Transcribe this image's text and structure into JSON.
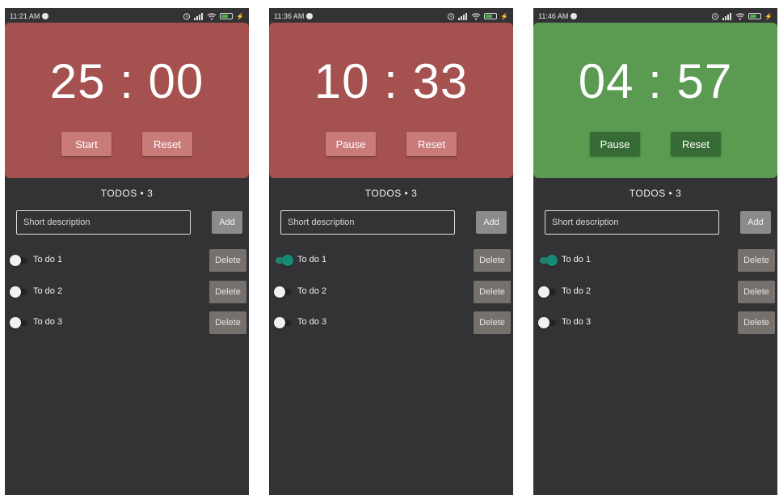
{
  "colors": {
    "app_bg": "#333336",
    "timer_red": "#a45150",
    "timer_green": "#5a9a51",
    "btn_red": "#c97b7a",
    "btn_green": "#376b36",
    "switch_on": "#178a76",
    "battery_fill": "#4cb34a",
    "delete_btn": "#77716d",
    "add_btn": "#8b8b8b"
  },
  "screens": [
    {
      "status": {
        "time": "11:21 AM",
        "battery": "63"
      },
      "timer": {
        "time": "25 : 00",
        "primary_label": "Start",
        "reset_label": "Reset",
        "color": "red"
      },
      "todos_title": "TODOS • 3",
      "input": {
        "placeholder": "Short description",
        "value": ""
      },
      "add_label": "Add",
      "todos": [
        {
          "label": "To do 1",
          "done": false,
          "delete_label": "Delete"
        },
        {
          "label": "To do 2",
          "done": false,
          "delete_label": "Delete"
        },
        {
          "label": "To do 3",
          "done": false,
          "delete_label": "Delete"
        }
      ]
    },
    {
      "status": {
        "time": "11:36 AM",
        "battery": "63"
      },
      "timer": {
        "time": "10 : 33",
        "primary_label": "Pause",
        "reset_label": "Reset",
        "color": "red"
      },
      "todos_title": "TODOS • 3",
      "input": {
        "placeholder": "Short description",
        "value": ""
      },
      "add_label": "Add",
      "todos": [
        {
          "label": "To do 1",
          "done": true,
          "delete_label": "Delete"
        },
        {
          "label": "To do 2",
          "done": false,
          "delete_label": "Delete"
        },
        {
          "label": "To do 3",
          "done": false,
          "delete_label": "Delete"
        }
      ]
    },
    {
      "status": {
        "time": "11:46 AM",
        "battery": "63"
      },
      "timer": {
        "time": "04 : 57",
        "primary_label": "Pause",
        "reset_label": "Reset",
        "color": "green"
      },
      "todos_title": "TODOS • 3",
      "input": {
        "placeholder": "Short description",
        "value": ""
      },
      "add_label": "Add",
      "todos": [
        {
          "label": "To do 1",
          "done": true,
          "delete_label": "Delete"
        },
        {
          "label": "To do 2",
          "done": false,
          "delete_label": "Delete"
        },
        {
          "label": "To do 3",
          "done": false,
          "delete_label": "Delete"
        }
      ]
    }
  ]
}
